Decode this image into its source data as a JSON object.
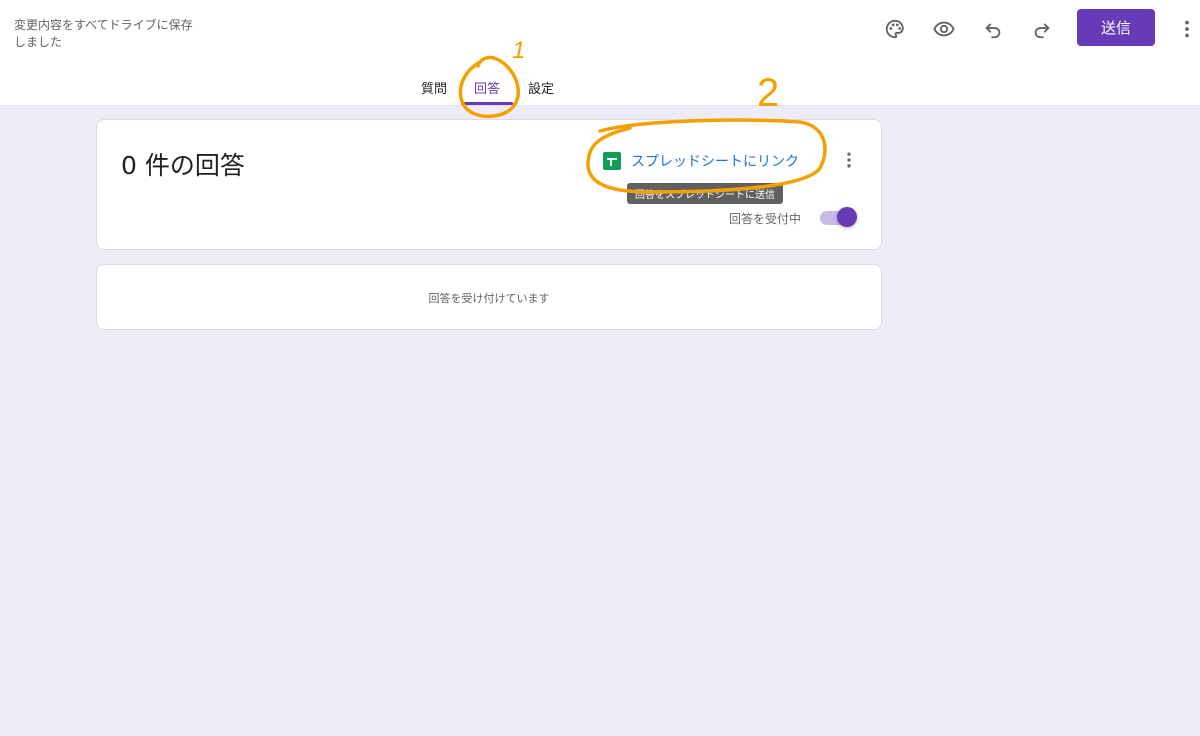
{
  "header": {
    "save_status": "変更内容をすべてドライブに保存しました",
    "send_label": "送信",
    "icons": [
      "palette-icon",
      "eye-icon",
      "undo-icon",
      "redo-icon",
      "more-vert-icon"
    ]
  },
  "tabs": [
    {
      "label": "質問"
    },
    {
      "label": "回答",
      "active": true
    },
    {
      "label": "設定"
    }
  ],
  "responses": {
    "count_text": "0 件の回答",
    "link_sheets_label": "スプレッドシートにリンク",
    "tooltip": "回答をスプレッドシートに送信",
    "accepting_label": "回答を受付中",
    "accepting": true,
    "empty_message": "回答を受け付けています"
  },
  "annotations": {
    "mark_1": "1",
    "mark_2": "2"
  },
  "colors": {
    "accent": "#673ab7",
    "background": "#efebf8",
    "annotation": "#f4a000",
    "sheets_green": "#0f9d58",
    "link_blue": "#1a73e8"
  }
}
